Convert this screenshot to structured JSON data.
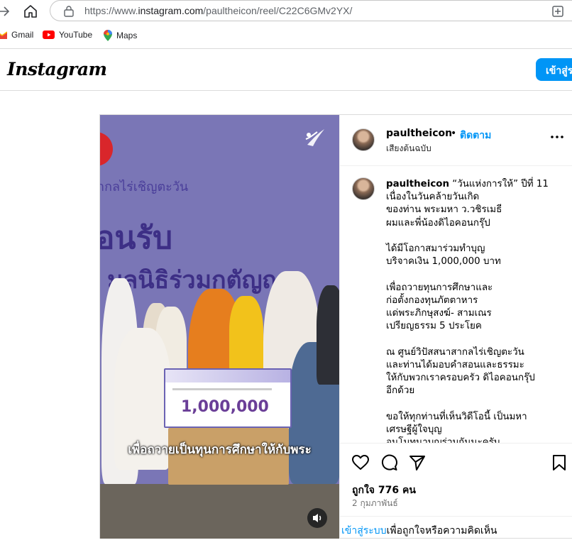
{
  "browser": {
    "url_prefix": "https://www.",
    "url_host": "instagram.com",
    "url_path": "/paultheicon/reel/C22C6GMv2YX/",
    "bookmarks": [
      {
        "label": "Gmail",
        "icon": "gmail-icon"
      },
      {
        "label": "YouTube",
        "icon": "youtube-icon"
      },
      {
        "label": "Maps",
        "icon": "maps-icon"
      }
    ]
  },
  "header": {
    "logo": "Instagram",
    "login_button": "เข้าสู่ระบบ"
  },
  "post": {
    "username": "paultheicon",
    "separator": "•",
    "follow": "ติดตาม",
    "audio": "เสียงต้นฉบับ",
    "caption_user": "paultheicon",
    "caption_text": " “วันแห่งการให้” ปีที่ 11\nเนื่องในวันคล้ายวันเกิด\nของท่าน พระมหา ว.วชิรเมธี\nผมและพี่น้องดิไอคอนกรุ๊ป\n\nได้มีโอกาสมาร่วมทำบุญ\nบริจาคเงิน 1,000,000 บาท\n\nเพื่อถวายทุนการศึกษาและ\nก่อตั้งกองทุนภัตตาหาร\nแด่พระภิกษุสงฆ์- สามเณร\nเปรียญธรรม 5 ประโยค\n\nณ ศูนย์วิปัสสนาสากลไร่เชิญตะวัน\nและท่านได้มอบคำสอนและธรรมะ\nให้กับพวกเราครอบครัว ดิไอคอนกรุ๊ป\nอีกด้วย\n\nขอให้ทุกท่านที่เห็นวิดีโอนี้ เป็นมหา\nเศรษฐีผู้ใจบุญ\nอนโมทนาบุญร่วมกันนะครับ",
    "likes": "ถูกใจ 776 คน",
    "date": "2 กุมภาพันธ์",
    "login_link": "เข้าสู่ระบบ",
    "login_rest": "เพื่อถูกใจหรือความคิดเห็น"
  },
  "media": {
    "sign_line1": "ากลไร่เชิญตะวัน",
    "sign_line2": "อนรับ",
    "sign_line3": "มูลนิธิร่วมกตัญญู",
    "cheque_amount": "1,000,000",
    "subtitle": "เพื่อถวายเป็นทุนการศึกษาให้กับพระ"
  }
}
